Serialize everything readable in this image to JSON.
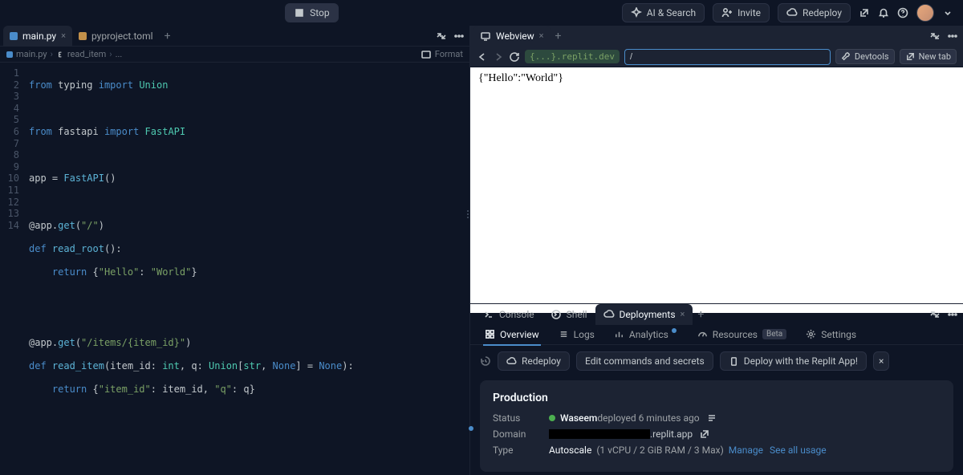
{
  "topbar": {
    "stop": "Stop",
    "ai_search": "AI & Search",
    "invite": "Invite",
    "redeploy": "Redeploy"
  },
  "left_tabs": {
    "active": "main.py",
    "other": "pyproject.toml"
  },
  "breadcrumb": {
    "file": "main.py",
    "symbol": "read_item",
    "more": "...",
    "format": "Format"
  },
  "code_lines": [
    "1",
    "2",
    "3",
    "4",
    "5",
    "6",
    "7",
    "8",
    "9",
    "10",
    "11",
    "12",
    "13",
    "14"
  ],
  "right_tabs": {
    "webview": "Webview"
  },
  "urlbar": {
    "host": "{...}.replit.dev",
    "path": "/",
    "devtools": "Devtools",
    "newtab": "New tab"
  },
  "webview_body": "{\"Hello\":\"World\"}",
  "bottom_tabs": {
    "console": "Console",
    "shell": "Shell",
    "deployments": "Deployments"
  },
  "deploy_nav": {
    "overview": "Overview",
    "logs": "Logs",
    "analytics": "Analytics",
    "resources": "Resources",
    "beta": "Beta",
    "settings": "Settings"
  },
  "deploy_toolbar": {
    "redeploy": "Redeploy",
    "edit": "Edit commands and secrets",
    "app": "Deploy with the Replit App!"
  },
  "deploy_card": {
    "title": "Production",
    "status_label": "Status",
    "status_user": "Waseem",
    "status_text": " deployed 6 minutes ago",
    "domain_label": "Domain",
    "domain_suffix": ".replit.app",
    "type_label": "Type",
    "type_value": "Autoscale",
    "type_detail": "(1 vCPU / 2 GiB RAM / 3 Max)",
    "manage": "Manage",
    "usage": "See all usage"
  }
}
